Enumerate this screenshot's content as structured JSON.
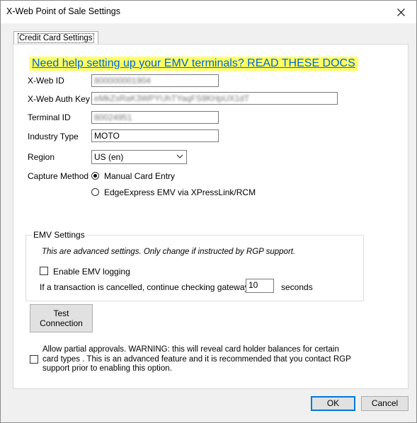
{
  "window": {
    "title": "X-Web Point of Sale Settings"
  },
  "tab": {
    "label": "Credit Card Settings"
  },
  "help_link": "Need help setting up your EMV terminals?  READ THESE DOCS",
  "fields": {
    "xweb_id": {
      "label": "X-Web ID",
      "value": "800000001904"
    },
    "auth_key": {
      "label": "X-Web Auth Key",
      "value": "eMkZsRaK3WPYUhTYaqFS9KHpUX1dT"
    },
    "terminal_id": {
      "label": "Terminal ID",
      "value": "80024951"
    },
    "industry_type": {
      "label": "Industry Type",
      "value": "MOTO"
    },
    "region": {
      "label": "Region",
      "value": "US (en)"
    }
  },
  "capture": {
    "label": "Capture Method",
    "options": [
      "Manual Card Entry",
      "EdgeExpress EMV via XPressLink/RCM"
    ],
    "selected": "Manual Card Entry"
  },
  "emv": {
    "legend": "EMV Settings",
    "note": "This are advanced settings. Only change if instructed by RGP support.",
    "logging_label": "Enable EMV logging",
    "logging_checked": false,
    "timeout_prefix": "If a transaction is cancelled, continue checking gateway for",
    "timeout_value": "10",
    "timeout_suffix": "seconds"
  },
  "test_button": {
    "line1": "Test",
    "line2": "Connection"
  },
  "partial": {
    "checked": false,
    "line1": "Allow partial approvals.  WARNING:  this will reveal card holder balances for certain",
    "line2": "card types .  This is an advanced feature and it is recommended that you contact RGP",
    "line3": "support prior to enabling this option."
  },
  "buttons": {
    "ok": "OK",
    "cancel": "Cancel"
  },
  "colors": {
    "help_highlight": "#ffff66",
    "link": "#0066cc",
    "focus": "#0078d7"
  }
}
